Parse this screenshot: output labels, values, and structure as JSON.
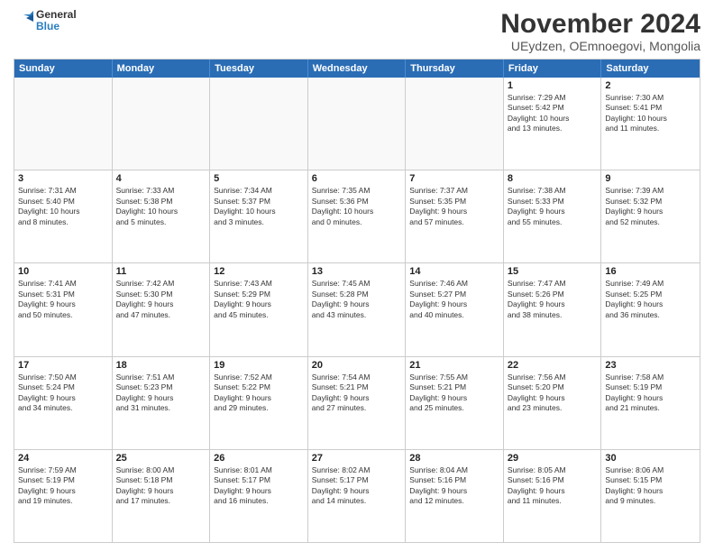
{
  "logo": {
    "line1": "General",
    "line2": "Blue"
  },
  "title": "November 2024",
  "subtitle": "UEydzen, OEmnoegovi, Mongolia",
  "header_days": [
    "Sunday",
    "Monday",
    "Tuesday",
    "Wednesday",
    "Thursday",
    "Friday",
    "Saturday"
  ],
  "weeks": [
    [
      {
        "day": "",
        "info": ""
      },
      {
        "day": "",
        "info": ""
      },
      {
        "day": "",
        "info": ""
      },
      {
        "day": "",
        "info": ""
      },
      {
        "day": "",
        "info": ""
      },
      {
        "day": "1",
        "info": "Sunrise: 7:29 AM\nSunset: 5:42 PM\nDaylight: 10 hours\nand 13 minutes."
      },
      {
        "day": "2",
        "info": "Sunrise: 7:30 AM\nSunset: 5:41 PM\nDaylight: 10 hours\nand 11 minutes."
      }
    ],
    [
      {
        "day": "3",
        "info": "Sunrise: 7:31 AM\nSunset: 5:40 PM\nDaylight: 10 hours\nand 8 minutes."
      },
      {
        "day": "4",
        "info": "Sunrise: 7:33 AM\nSunset: 5:38 PM\nDaylight: 10 hours\nand 5 minutes."
      },
      {
        "day": "5",
        "info": "Sunrise: 7:34 AM\nSunset: 5:37 PM\nDaylight: 10 hours\nand 3 minutes."
      },
      {
        "day": "6",
        "info": "Sunrise: 7:35 AM\nSunset: 5:36 PM\nDaylight: 10 hours\nand 0 minutes."
      },
      {
        "day": "7",
        "info": "Sunrise: 7:37 AM\nSunset: 5:35 PM\nDaylight: 9 hours\nand 57 minutes."
      },
      {
        "day": "8",
        "info": "Sunrise: 7:38 AM\nSunset: 5:33 PM\nDaylight: 9 hours\nand 55 minutes."
      },
      {
        "day": "9",
        "info": "Sunrise: 7:39 AM\nSunset: 5:32 PM\nDaylight: 9 hours\nand 52 minutes."
      }
    ],
    [
      {
        "day": "10",
        "info": "Sunrise: 7:41 AM\nSunset: 5:31 PM\nDaylight: 9 hours\nand 50 minutes."
      },
      {
        "day": "11",
        "info": "Sunrise: 7:42 AM\nSunset: 5:30 PM\nDaylight: 9 hours\nand 47 minutes."
      },
      {
        "day": "12",
        "info": "Sunrise: 7:43 AM\nSunset: 5:29 PM\nDaylight: 9 hours\nand 45 minutes."
      },
      {
        "day": "13",
        "info": "Sunrise: 7:45 AM\nSunset: 5:28 PM\nDaylight: 9 hours\nand 43 minutes."
      },
      {
        "day": "14",
        "info": "Sunrise: 7:46 AM\nSunset: 5:27 PM\nDaylight: 9 hours\nand 40 minutes."
      },
      {
        "day": "15",
        "info": "Sunrise: 7:47 AM\nSunset: 5:26 PM\nDaylight: 9 hours\nand 38 minutes."
      },
      {
        "day": "16",
        "info": "Sunrise: 7:49 AM\nSunset: 5:25 PM\nDaylight: 9 hours\nand 36 minutes."
      }
    ],
    [
      {
        "day": "17",
        "info": "Sunrise: 7:50 AM\nSunset: 5:24 PM\nDaylight: 9 hours\nand 34 minutes."
      },
      {
        "day": "18",
        "info": "Sunrise: 7:51 AM\nSunset: 5:23 PM\nDaylight: 9 hours\nand 31 minutes."
      },
      {
        "day": "19",
        "info": "Sunrise: 7:52 AM\nSunset: 5:22 PM\nDaylight: 9 hours\nand 29 minutes."
      },
      {
        "day": "20",
        "info": "Sunrise: 7:54 AM\nSunset: 5:21 PM\nDaylight: 9 hours\nand 27 minutes."
      },
      {
        "day": "21",
        "info": "Sunrise: 7:55 AM\nSunset: 5:21 PM\nDaylight: 9 hours\nand 25 minutes."
      },
      {
        "day": "22",
        "info": "Sunrise: 7:56 AM\nSunset: 5:20 PM\nDaylight: 9 hours\nand 23 minutes."
      },
      {
        "day": "23",
        "info": "Sunrise: 7:58 AM\nSunset: 5:19 PM\nDaylight: 9 hours\nand 21 minutes."
      }
    ],
    [
      {
        "day": "24",
        "info": "Sunrise: 7:59 AM\nSunset: 5:19 PM\nDaylight: 9 hours\nand 19 minutes."
      },
      {
        "day": "25",
        "info": "Sunrise: 8:00 AM\nSunset: 5:18 PM\nDaylight: 9 hours\nand 17 minutes."
      },
      {
        "day": "26",
        "info": "Sunrise: 8:01 AM\nSunset: 5:17 PM\nDaylight: 9 hours\nand 16 minutes."
      },
      {
        "day": "27",
        "info": "Sunrise: 8:02 AM\nSunset: 5:17 PM\nDaylight: 9 hours\nand 14 minutes."
      },
      {
        "day": "28",
        "info": "Sunrise: 8:04 AM\nSunset: 5:16 PM\nDaylight: 9 hours\nand 12 minutes."
      },
      {
        "day": "29",
        "info": "Sunrise: 8:05 AM\nSunset: 5:16 PM\nDaylight: 9 hours\nand 11 minutes."
      },
      {
        "day": "30",
        "info": "Sunrise: 8:06 AM\nSunset: 5:15 PM\nDaylight: 9 hours\nand 9 minutes."
      }
    ]
  ]
}
